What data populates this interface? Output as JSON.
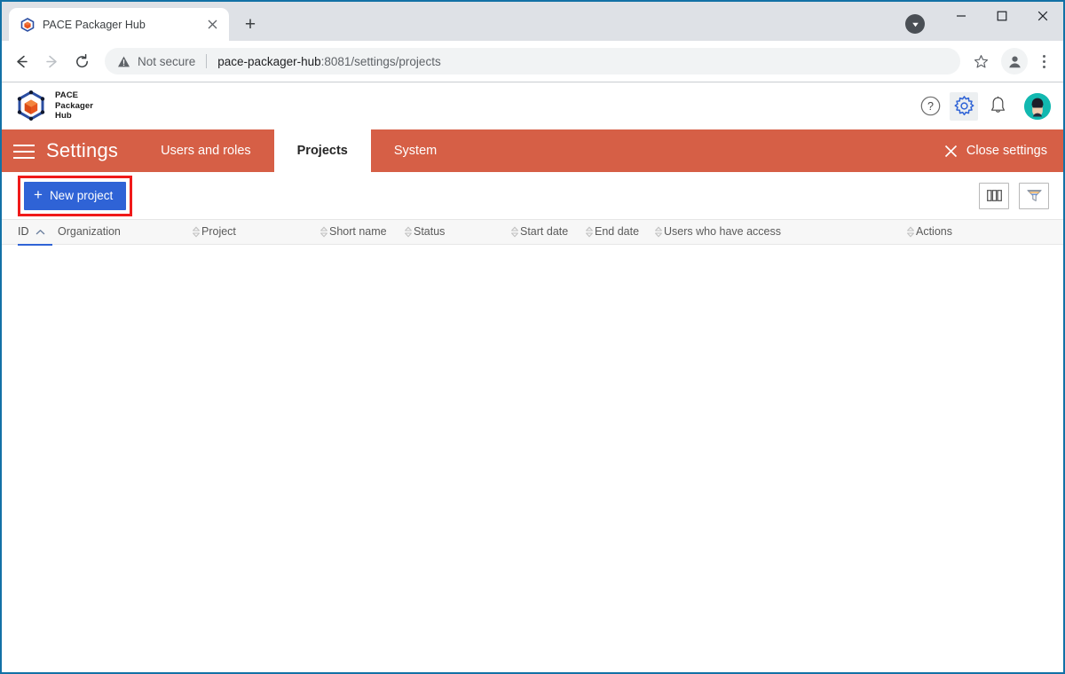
{
  "browser": {
    "tab": {
      "title": "PACE Packager Hub",
      "favicon_icon": "pace-cube-favicon",
      "close_icon": "close-icon"
    },
    "new_tab_label": "+",
    "nav": {
      "back_icon": "arrow-back-icon",
      "forward_icon": "arrow-forward-icon",
      "reload_icon": "reload-icon"
    },
    "omnibox": {
      "security_icon": "not-secure-warning-icon",
      "security_text": "Not secure",
      "url_host": "pace-packager-hub",
      "url_rest": ":8081/settings/projects",
      "url_full": "pace-packager-hub:8081/settings/projects",
      "bookmark_icon": "star-icon"
    },
    "profile_icon": "profile-avatar-icon",
    "menu_icon": "three-dot-menu-icon",
    "downloads_icon": "downloads-chevron-icon",
    "window_controls": {
      "minimize": "minimize-icon",
      "maximize": "maximize-icon",
      "close": "window-close-icon"
    }
  },
  "app_header": {
    "logo_icon": "pace-cube-logo",
    "brand_line1": "PACE",
    "brand_line2": "Packager",
    "brand_line3": "Hub",
    "actions": [
      {
        "name": "help-icon",
        "glyph": "?"
      },
      {
        "name": "gear-icon",
        "glyph": ""
      },
      {
        "name": "bell-icon",
        "glyph": ""
      }
    ],
    "avatar_icon": "user-avatar"
  },
  "settings_bar": {
    "menu_icon": "hamburger-menu-icon",
    "title": "Settings",
    "tabs": [
      {
        "label": "Users and roles",
        "active": false
      },
      {
        "label": "Projects",
        "active": true
      },
      {
        "label": "System",
        "active": false
      }
    ],
    "close_label": "Close settings",
    "close_icon": "close-x-icon",
    "accent_color": "#d65f46"
  },
  "toolbar": {
    "new_project_label": "New project",
    "new_project_icon": "plus-icon",
    "new_project_color": "#2f63d6",
    "highlight_color": "#f01a1a",
    "columns_button_icon": "columns-icon",
    "filter_button_icon": "funnel-filter-icon"
  },
  "table": {
    "columns": [
      {
        "label": "ID",
        "sorted": true,
        "sort_direction": "asc",
        "sort_icon": "chevron-up-icon"
      },
      {
        "label": "Organization",
        "sorted": false,
        "sort_icon": "sort-updown-icon"
      },
      {
        "label": "Project",
        "sorted": false,
        "sort_icon": "sort-updown-icon"
      },
      {
        "label": "Short name",
        "sorted": false,
        "sort_icon": "sort-updown-icon"
      },
      {
        "label": "Status",
        "sorted": false,
        "sort_icon": "sort-updown-icon"
      },
      {
        "label": "Start date",
        "sorted": false,
        "sort_icon": "sort-updown-icon"
      },
      {
        "label": "End date",
        "sorted": false,
        "sort_icon": "sort-updown-icon"
      },
      {
        "label": "Users who have access",
        "sorted": false,
        "sort_icon": "sort-updown-icon"
      },
      {
        "label": "Actions",
        "sorted": false,
        "sort_icon": "sort-updown-icon"
      }
    ],
    "rows": []
  }
}
